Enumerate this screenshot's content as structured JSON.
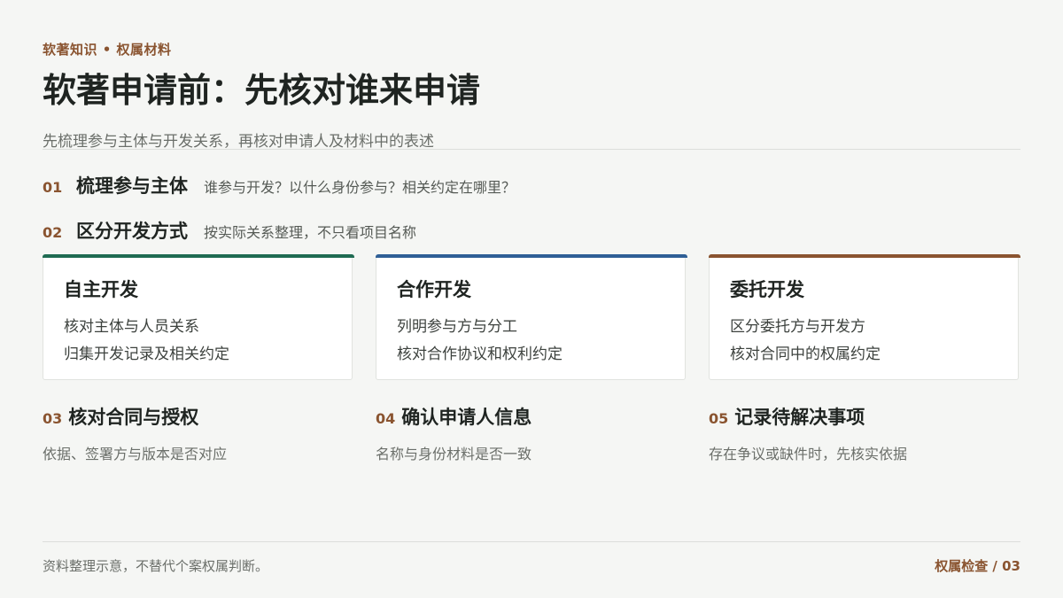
{
  "header": {
    "kicker": "软著知识 • 权属材料",
    "title": "软著申请前：先核对谁来申请",
    "subtitle": "先梳理参与主体与开发关系，再核对申请人及材料中的表述"
  },
  "steps": [
    {
      "num": "01",
      "title": "梳理参与主体",
      "desc": "谁参与开发？以什么身份参与？相关约定在哪里？"
    },
    {
      "num": "02",
      "title": "区分开发方式",
      "desc": "按实际关系整理，不只看项目名称"
    }
  ],
  "cards": [
    {
      "title": "自主开发",
      "lines": [
        "核对主体与人员关系",
        "归集开发记录及相关约定"
      ],
      "accent": "#1f6b52"
    },
    {
      "title": "合作开发",
      "lines": [
        "列明参与方与分工",
        "核对合作协议和权利约定"
      ],
      "accent": "#2f5f96"
    },
    {
      "title": "委托开发",
      "lines": [
        "区分委托方与开发方",
        "核对合同中的权属约定"
      ],
      "accent": "#8a5430"
    }
  ],
  "lower": [
    {
      "num": "03",
      "title": "核对合同与授权",
      "desc": "依据、签署方与版本是否对应"
    },
    {
      "num": "04",
      "title": "确认申请人信息",
      "desc": "名称与身份材料是否一致"
    },
    {
      "num": "05",
      "title": "记录待解决事项",
      "desc": "存在争议或缺件时，先核实依据"
    }
  ],
  "footer": {
    "note": "资料整理示意，不替代个案权属判断。",
    "page": "权属检查 / 03"
  },
  "colors": {
    "accent_brown": "#8a5430",
    "accent_green": "#1f6b52",
    "accent_blue": "#2f5f96",
    "background": "#f5f6f4"
  }
}
